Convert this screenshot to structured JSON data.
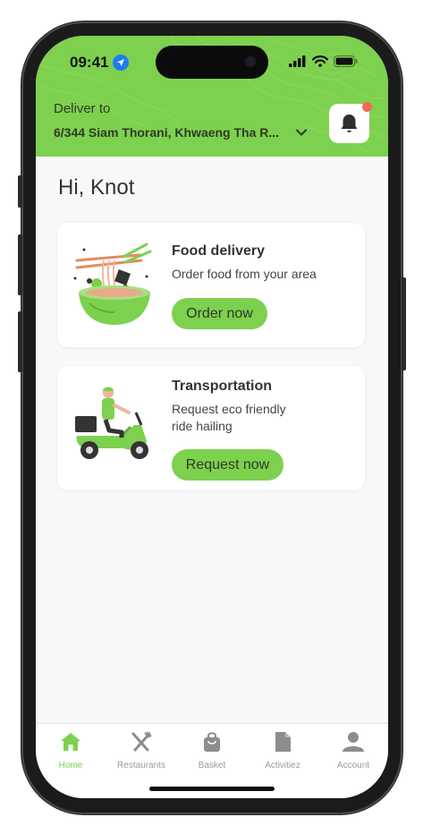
{
  "status_bar": {
    "time": "09:41"
  },
  "header": {
    "deliver_label": "Deliver to",
    "address": "6/344 Siam Thorani, Khwaeng Tha R...",
    "notification_badge": true
  },
  "greeting": "Hi, Knot",
  "cards": [
    {
      "title": "Food delivery",
      "description": "Order food from your area",
      "button": "Order now"
    },
    {
      "title": "Transportation",
      "description_lines": [
        "Request eco friendly",
        "ride hailing"
      ],
      "button": "Request now"
    }
  ],
  "tabs": [
    {
      "label": "Home",
      "icon": "home-icon",
      "active": true
    },
    {
      "label": "Restaurants",
      "icon": "fork-knife-icon",
      "active": false
    },
    {
      "label": "Basket",
      "icon": "bag-icon",
      "active": false
    },
    {
      "label": "Activitiez",
      "icon": "document-icon",
      "active": false
    },
    {
      "label": "Account",
      "icon": "person-icon",
      "active": false
    }
  ],
  "colors": {
    "accent": "#7ed04f",
    "badge": "#f26a5a",
    "location_blue": "#1f7cf6"
  }
}
